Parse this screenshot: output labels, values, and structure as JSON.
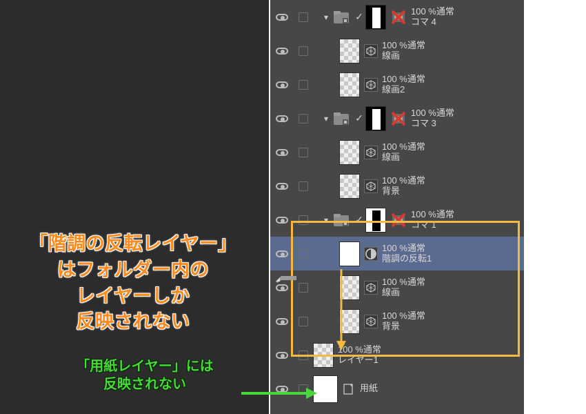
{
  "colors": {
    "panel_bg": "#474747",
    "dark_bg": "#2c2c2c",
    "highlight_border": "#f6b83e",
    "selected_row": "#5b6b8f",
    "annot_orange": "#ff8a1f",
    "annot_green": "#4bd63b"
  },
  "annotation_orange": "「階調の反転レイヤー」\nはフォルダー内の\nレイヤーしか\n反映されない",
  "annotation_green": "「用紙レイヤー」には\n反映されない",
  "rows": [
    {
      "kind": "folder",
      "indent": 1,
      "opacity": "100 %通常",
      "name": "コマ 4",
      "has_redx": true,
      "mask": "bw"
    },
    {
      "kind": "layer",
      "indent": 2,
      "opacity": "100 %通常",
      "name": "線画",
      "badge": "cube",
      "thumb": "checker"
    },
    {
      "kind": "layer",
      "indent": 2,
      "opacity": "100 %通常",
      "name": "線画2",
      "badge": "cube",
      "thumb": "checker"
    },
    {
      "kind": "folder",
      "indent": 1,
      "opacity": "100 %通常",
      "name": "コマ 3",
      "has_redx": true,
      "mask": "bw"
    },
    {
      "kind": "layer",
      "indent": 2,
      "opacity": "100 %通常",
      "name": "線画",
      "badge": "cube",
      "thumb": "checker"
    },
    {
      "kind": "layer",
      "indent": 2,
      "opacity": "100 %通常",
      "name": "背景",
      "badge": "cube",
      "thumb": "checker"
    },
    {
      "kind": "folder",
      "indent": 1,
      "opacity": "100 %通常",
      "name": "コマ 1",
      "has_redx": true,
      "mask": "wb"
    },
    {
      "kind": "layer",
      "indent": 2,
      "opacity": "100 %通常",
      "name": "階調の反転1",
      "badge": "adj",
      "thumb": "white",
      "selected": true
    },
    {
      "kind": "layer",
      "indent": 2,
      "opacity": "100 %通常",
      "name": "線画",
      "badge": "cube",
      "thumb": "checker"
    },
    {
      "kind": "layer",
      "indent": 2,
      "opacity": "100 %通常",
      "name": "背景",
      "badge": "cube",
      "thumb": "checker"
    },
    {
      "kind": "layer",
      "indent": 0,
      "opacity": "100 %通常",
      "name": "レイヤー1",
      "badge": "none",
      "thumb": "checker"
    },
    {
      "kind": "paper",
      "indent": 0,
      "opacity": "",
      "name": "用紙",
      "badge": "paper",
      "thumb": "white-big"
    }
  ]
}
